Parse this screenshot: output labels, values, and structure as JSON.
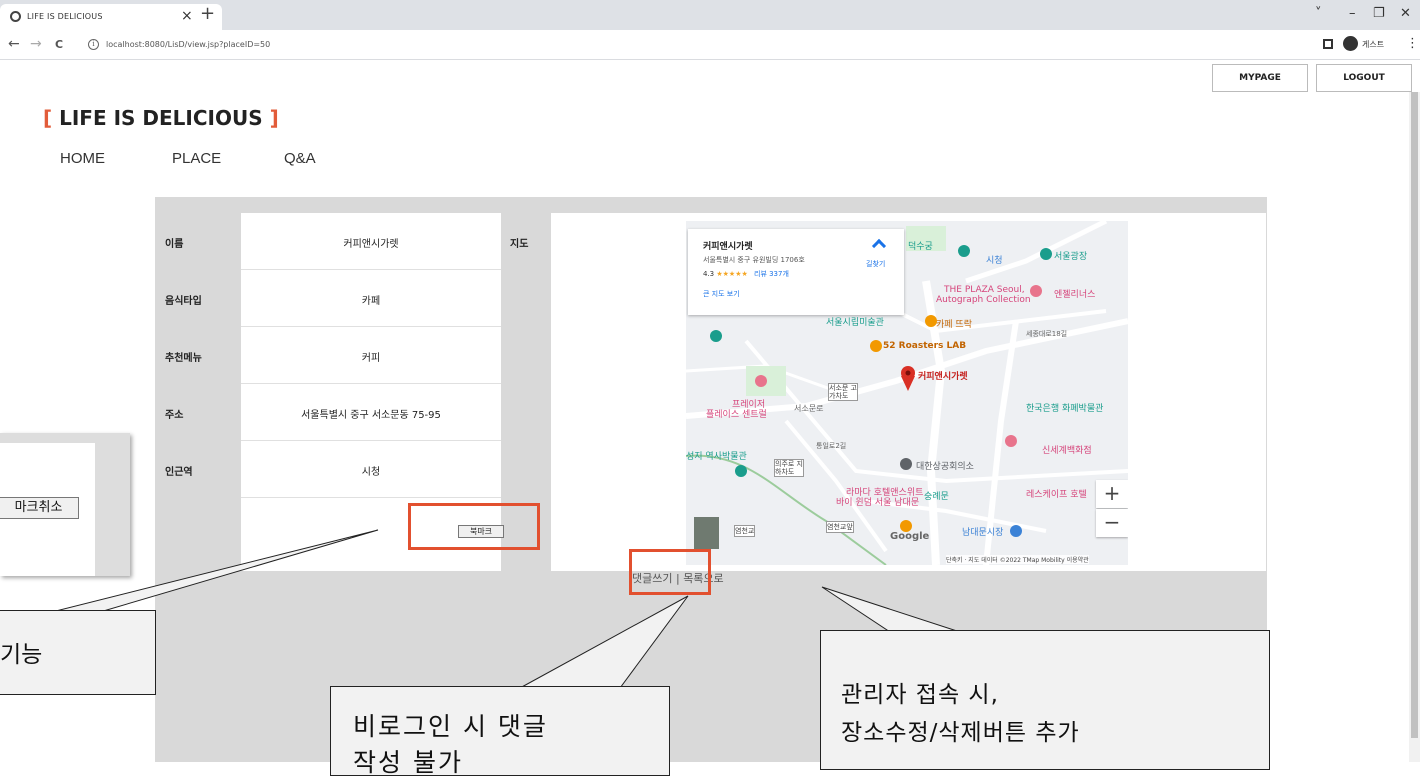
{
  "browser": {
    "tab_title": "LIFE IS DELICIOUS",
    "tab_close": "×",
    "new_tab": "+",
    "url_info": "i",
    "url": "localhost:8080/LisD/view.jsp?placeID=50",
    "profile": "게스트",
    "back": "←",
    "forward": "→",
    "reload": "C",
    "minimize": "–",
    "restore": "❐",
    "close": "✕",
    "tab_search": "˅",
    "menu": "⋮"
  },
  "header": {
    "mypage": "MYPAGE",
    "logout": "LOGOUT",
    "brand_open": "[",
    "brand": " LIFE IS DELICIOUS ",
    "brand_close": "]"
  },
  "nav": {
    "home": "HOME",
    "place": "PLACE",
    "qna": "Q&A"
  },
  "place": {
    "rows": [
      {
        "label": "이름",
        "value": "커피앤시가렛"
      },
      {
        "label": "음식타입",
        "value": "카페"
      },
      {
        "label": "추천메뉴",
        "value": "커피"
      },
      {
        "label": "주소",
        "value": "서울특별시 중구 서소문동 75-95"
      },
      {
        "label": "인근역",
        "value": "시청"
      }
    ],
    "map_label": "지도",
    "bookmark_button": "북마크"
  },
  "footer": {
    "write_comment": "댓글쓰기",
    "separator": " | ",
    "to_list": "목록으로"
  },
  "map": {
    "card_title": "커피앤시가렛",
    "card_address": "서울특별시 중구 유원빌딩 1706호",
    "card_rating": "4.3",
    "card_stars": "★★★★★",
    "card_reviews": "리뷰 337개",
    "card_bigmap": "큰 지도 보기",
    "card_directions": "길찾기",
    "labels": [
      "덕수궁",
      "시청",
      "서울광장",
      "THE PLAZA Seoul,",
      "Autograph Collection",
      "엔젤리너스",
      "서울시립미술관",
      "카페 뜨락",
      "52 Roasters LAB",
      "커피앤시가렛",
      "프레이저",
      "플레이스 센트럴",
      "서소문로",
      "한국은행 화폐박물관",
      "신세계백화점",
      "대한상공회의소",
      "라마다 호텔앤스위트",
      "바이 윈덤 서울 남대문",
      "숭례문",
      "레스케이프 호텔",
      "남대문시장",
      "성지 역사박물관",
      "세종대로18길",
      "통일로2길",
      "염천교",
      "Google",
      "단축키",
      "지도 데이터 ©2022 TMap Mobility",
      "이용약관",
      "서소문 고가차도",
      "의주로 지하차도",
      "염천교앞"
    ],
    "zoom_in": "+",
    "zoom_out": "−"
  },
  "annotations": {
    "bookmark_popup_button": "마크취소",
    "bookmark_callout": "기능",
    "login_callout_line1": "비로그인 시 댓글",
    "login_callout_line2": "작성 불가",
    "admin_callout_line1": "관리자 접속 시,",
    "admin_callout_line2": "장소수정/삭제버튼 추가"
  },
  "colors": {
    "accent": "#e25c3a",
    "highlight_box": "#e2502f",
    "board": "#d9d9d9"
  }
}
